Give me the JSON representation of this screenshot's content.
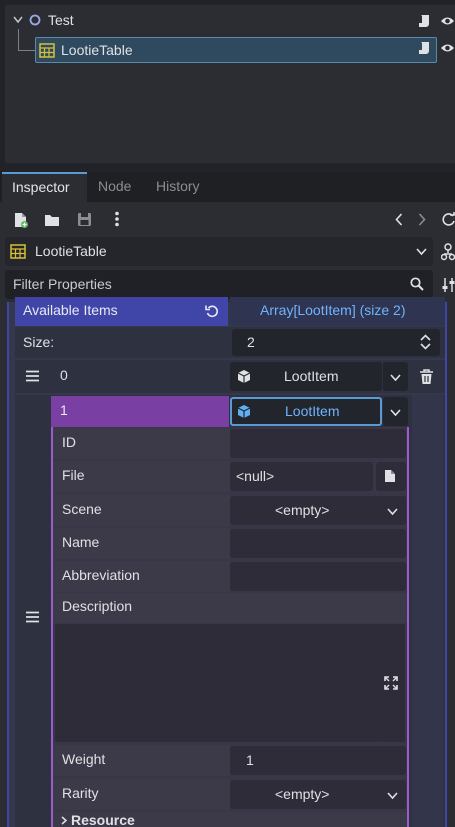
{
  "scene_tree": {
    "root_label": "Test",
    "child_label": "LootieTable"
  },
  "tabs": [
    {
      "label": "Inspector"
    },
    {
      "label": "Node"
    },
    {
      "label": "History"
    }
  ],
  "object_selector": {
    "label": "LootieTable"
  },
  "filter": {
    "placeholder": "Filter Properties"
  },
  "available_items": {
    "label": "Available Items",
    "value": "Array[LootItem] (size 2)"
  },
  "size": {
    "label": "Size:",
    "value": "2"
  },
  "element0": {
    "index": "0",
    "type_label": "LootItem"
  },
  "element1": {
    "index": "1",
    "type_label": "LootItem",
    "props": {
      "id_label": "ID",
      "id_value": "",
      "file_label": "File",
      "file_value": "<null>",
      "scene_label": "Scene",
      "scene_value": "<empty>",
      "name_label": "Name",
      "name_value": "",
      "abbreviation_label": "Abbreviation",
      "abbreviation_value": "",
      "description_label": "Description",
      "description_value": "",
      "weight_label": "Weight",
      "weight_value": "1",
      "rarity_label": "Rarity",
      "rarity_value": "<empty>",
      "resource_label": "Resource"
    }
  },
  "colors": {
    "accent_blue": "#5b9bd5",
    "array_header": "#3f46a8",
    "element_header": "#7a3fa3",
    "element_border": "#9a5bd0"
  }
}
